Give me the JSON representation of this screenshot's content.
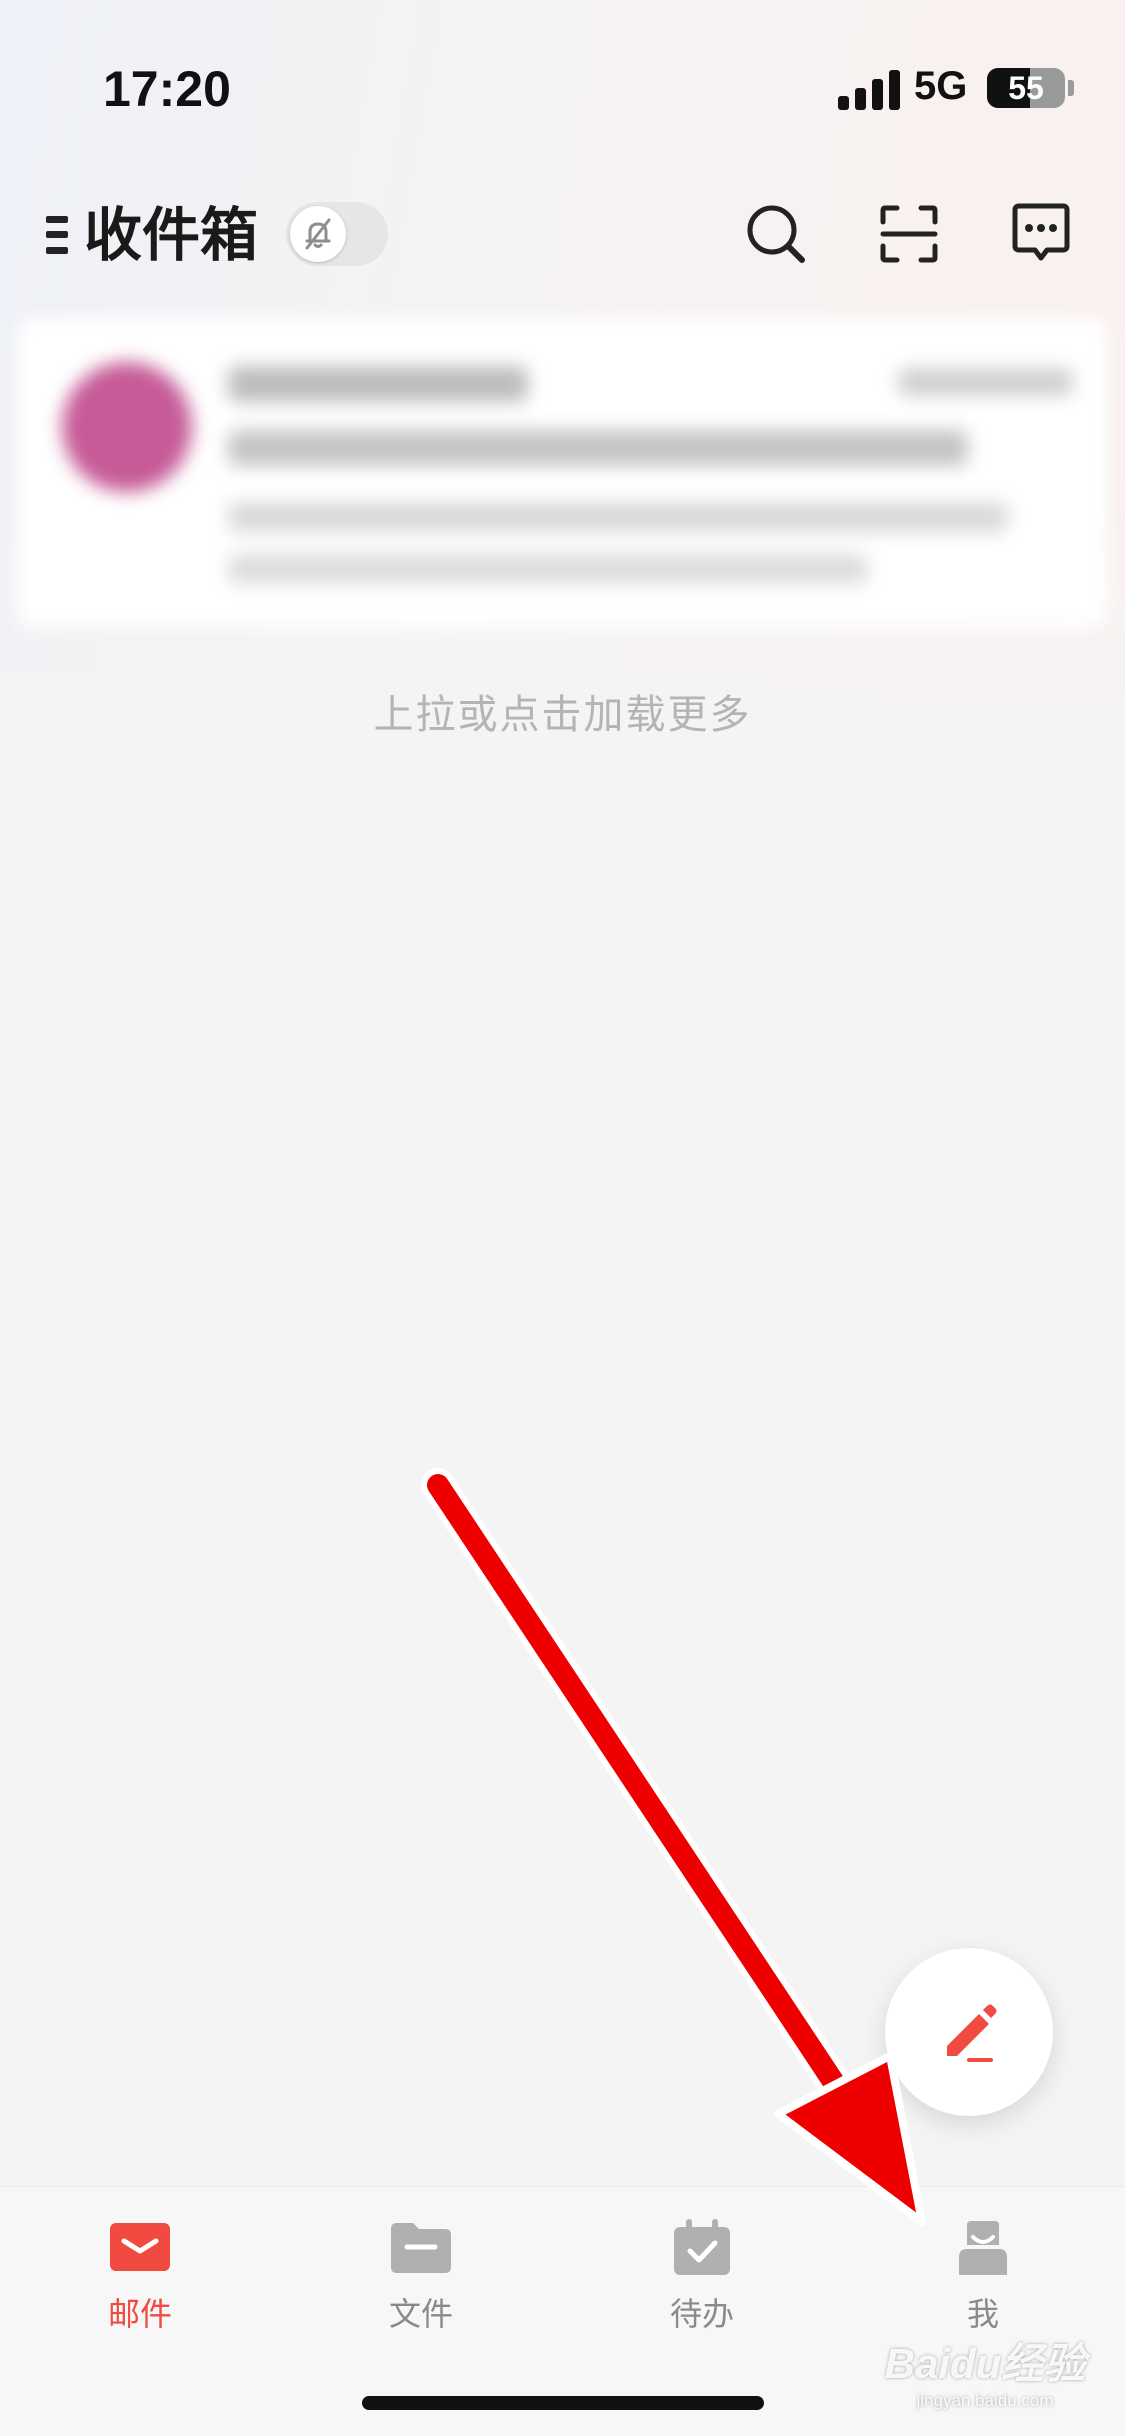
{
  "status_bar": {
    "time": "17:20",
    "network": "5G",
    "battery": "55",
    "battery_level": 0.55
  },
  "header": {
    "title": "收件箱",
    "menu_icon": "menu-icon",
    "dnd_icon": "bell-off-icon",
    "actions": [
      {
        "name": "search-button",
        "icon": "search-icon"
      },
      {
        "name": "scan-button",
        "icon": "scan-icon"
      },
      {
        "name": "chat-button",
        "icon": "message-icon"
      }
    ]
  },
  "mail_list": {
    "items": [
      {
        "sender": "",
        "blurred": true,
        "avatar_color": "#c65b97"
      }
    ],
    "load_more": "上拉或点击加载更多"
  },
  "fab": {
    "icon": "compose-pencil-icon",
    "color": "#f04a41"
  },
  "tabs": [
    {
      "label": "邮件",
      "icon": "mail-icon",
      "active": true
    },
    {
      "label": "文件",
      "icon": "folder-icon",
      "active": false
    },
    {
      "label": "待办",
      "icon": "calendar-check-icon",
      "active": false
    },
    {
      "label": "我",
      "icon": "user-icon",
      "active": false
    }
  ],
  "colors": {
    "accent": "#f04a41",
    "inactive": "#b0b0b0",
    "annotation_arrow": "#ee0000"
  },
  "watermark": {
    "brand": "Baidu经验",
    "url": "jingyan.baidu.com"
  }
}
